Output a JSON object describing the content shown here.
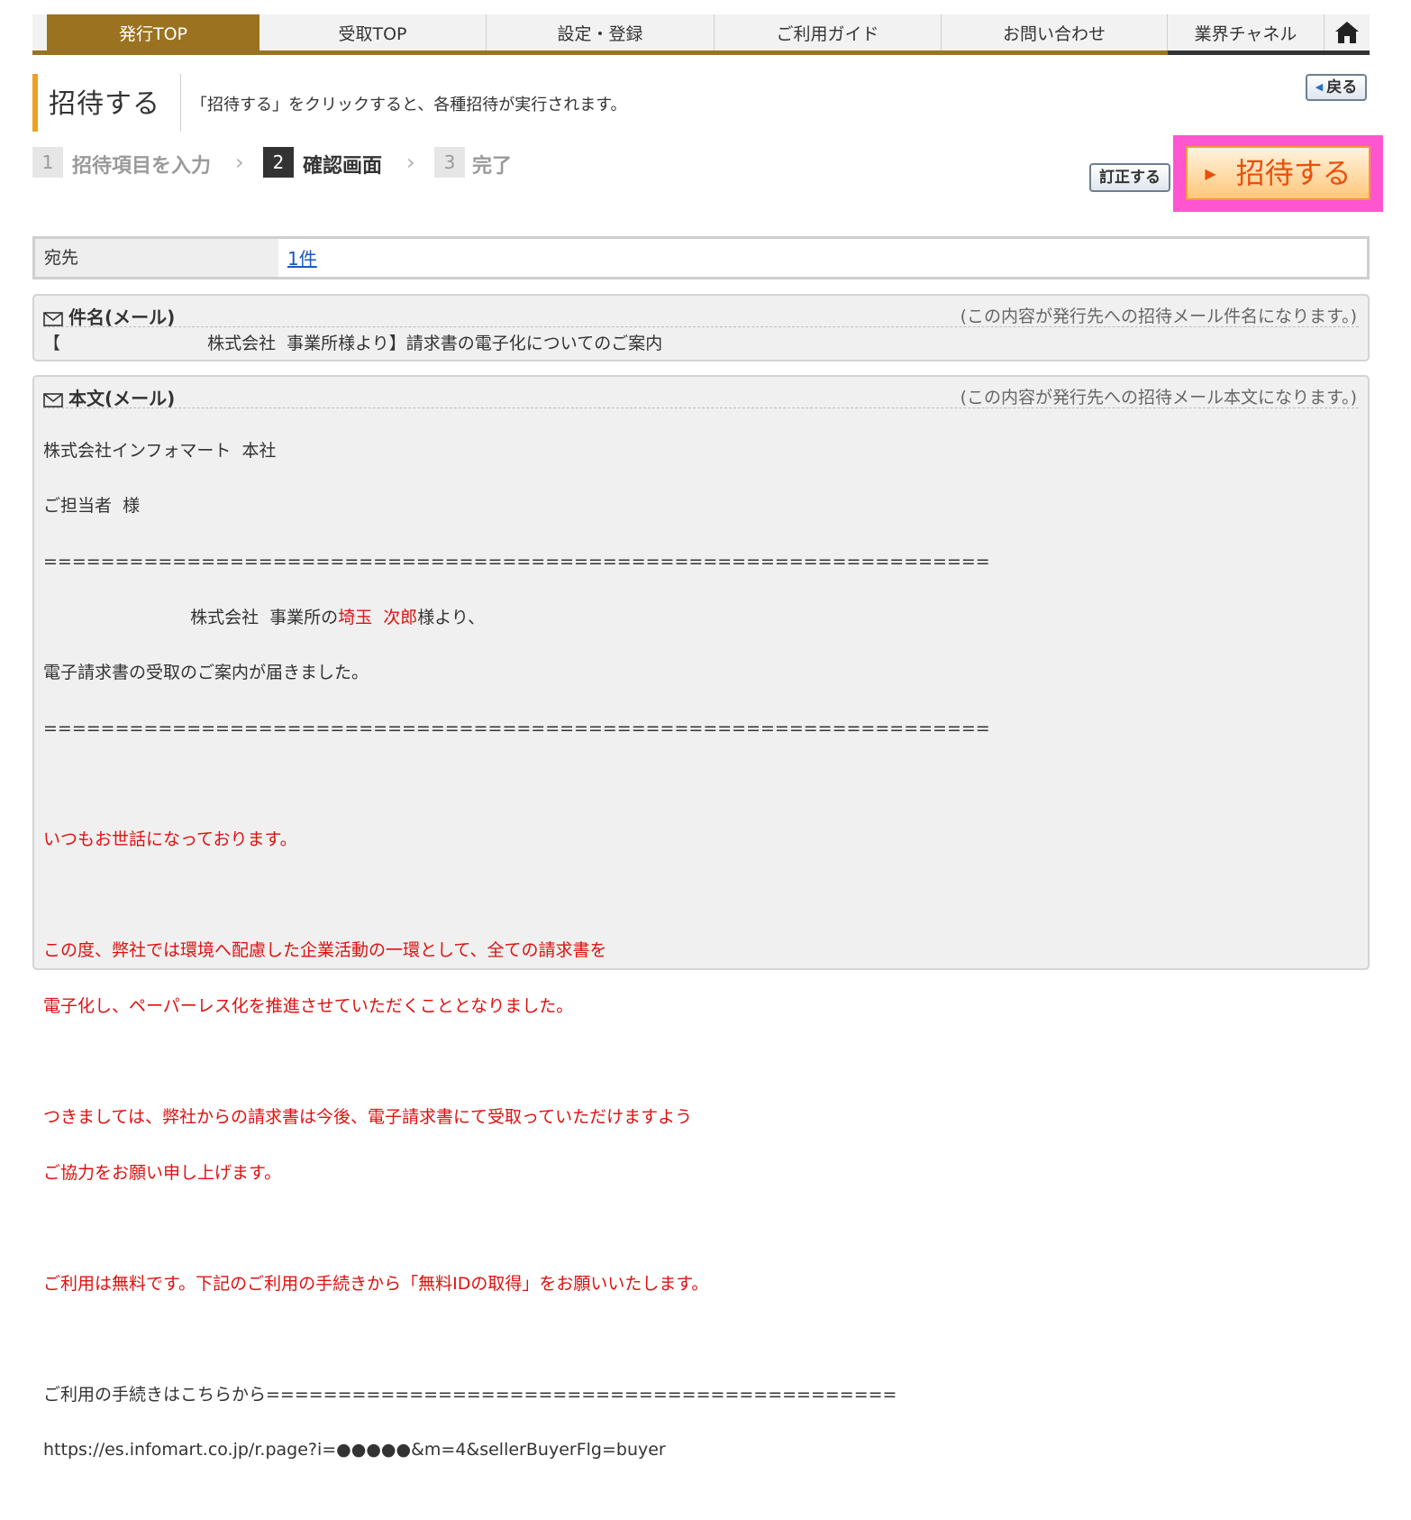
{
  "nav": {
    "tabs": [
      {
        "label": "発行TOP",
        "active": true
      },
      {
        "label": "受取TOP"
      },
      {
        "label": "設定・登録"
      },
      {
        "label": "ご利用ガイド"
      },
      {
        "label": "お問い合わせ"
      },
      {
        "label": "業界チャネル"
      }
    ],
    "home_icon": "home-icon"
  },
  "header": {
    "title": "招待する",
    "description": "「招待する」をクリックすると、各種招待が実行されます。",
    "back_label": "戻る"
  },
  "steps": [
    {
      "num": "1",
      "label": "招待項目を入力"
    },
    {
      "num": "2",
      "label": "確認画面",
      "current": true
    },
    {
      "num": "3",
      "label": "完了"
    }
  ],
  "actions": {
    "correct_label": "訂正する",
    "invite_label": "招待する"
  },
  "recipient": {
    "label": "宛先",
    "value": "1件"
  },
  "subject_panel": {
    "title": "件名(メール)",
    "note": "(この内容が発行先への招待メール件名になります。)",
    "text": "【                           株式会社  事業所様より】請求書の電子化についてのご案内"
  },
  "body_panel": {
    "title": "本文(メール)",
    "note": "(この内容が発行先への招待メール本文になります。)",
    "line1": "株式会社インフォマート  本社",
    "line2": "ご担当者  様",
    "separator": "==================================================================",
    "line3_prefix": "                           株式会社  事業所の",
    "line3_name": "埼玉  次郎",
    "line3_suffix": "様より、",
    "line4": "電子請求書の受取のご案内が届きました。",
    "red1": "いつもお世話になっております。",
    "red2": "この度、弊社では環境へ配慮した企業活動の一環として、全ての請求書を",
    "red3": "電子化し、ペーパーレス化を推進させていただくこととなりました。",
    "red4": "つきましては、弊社からの請求書は今後、電子請求書にて受取っていただけますよう",
    "red5": "ご協力をお願い申し上げます。",
    "red6": "ご利用は無料です。下記のご利用の手続きから「無料IDの取得」をお願いいたします。",
    "proc_line": "ご利用の手続きはこちらから============================================",
    "url": "https://es.infomart.co.jp/r.page?i=●●●●●&m=4&sellerBuyerFlg=buyer"
  },
  "colors": {
    "nav_active": "#9a7220",
    "title_accent": "#f0a020",
    "invite_text": "#e8500a",
    "highlight": "#ff55d0",
    "red_text": "#e01010",
    "link": "#1a56c4"
  }
}
